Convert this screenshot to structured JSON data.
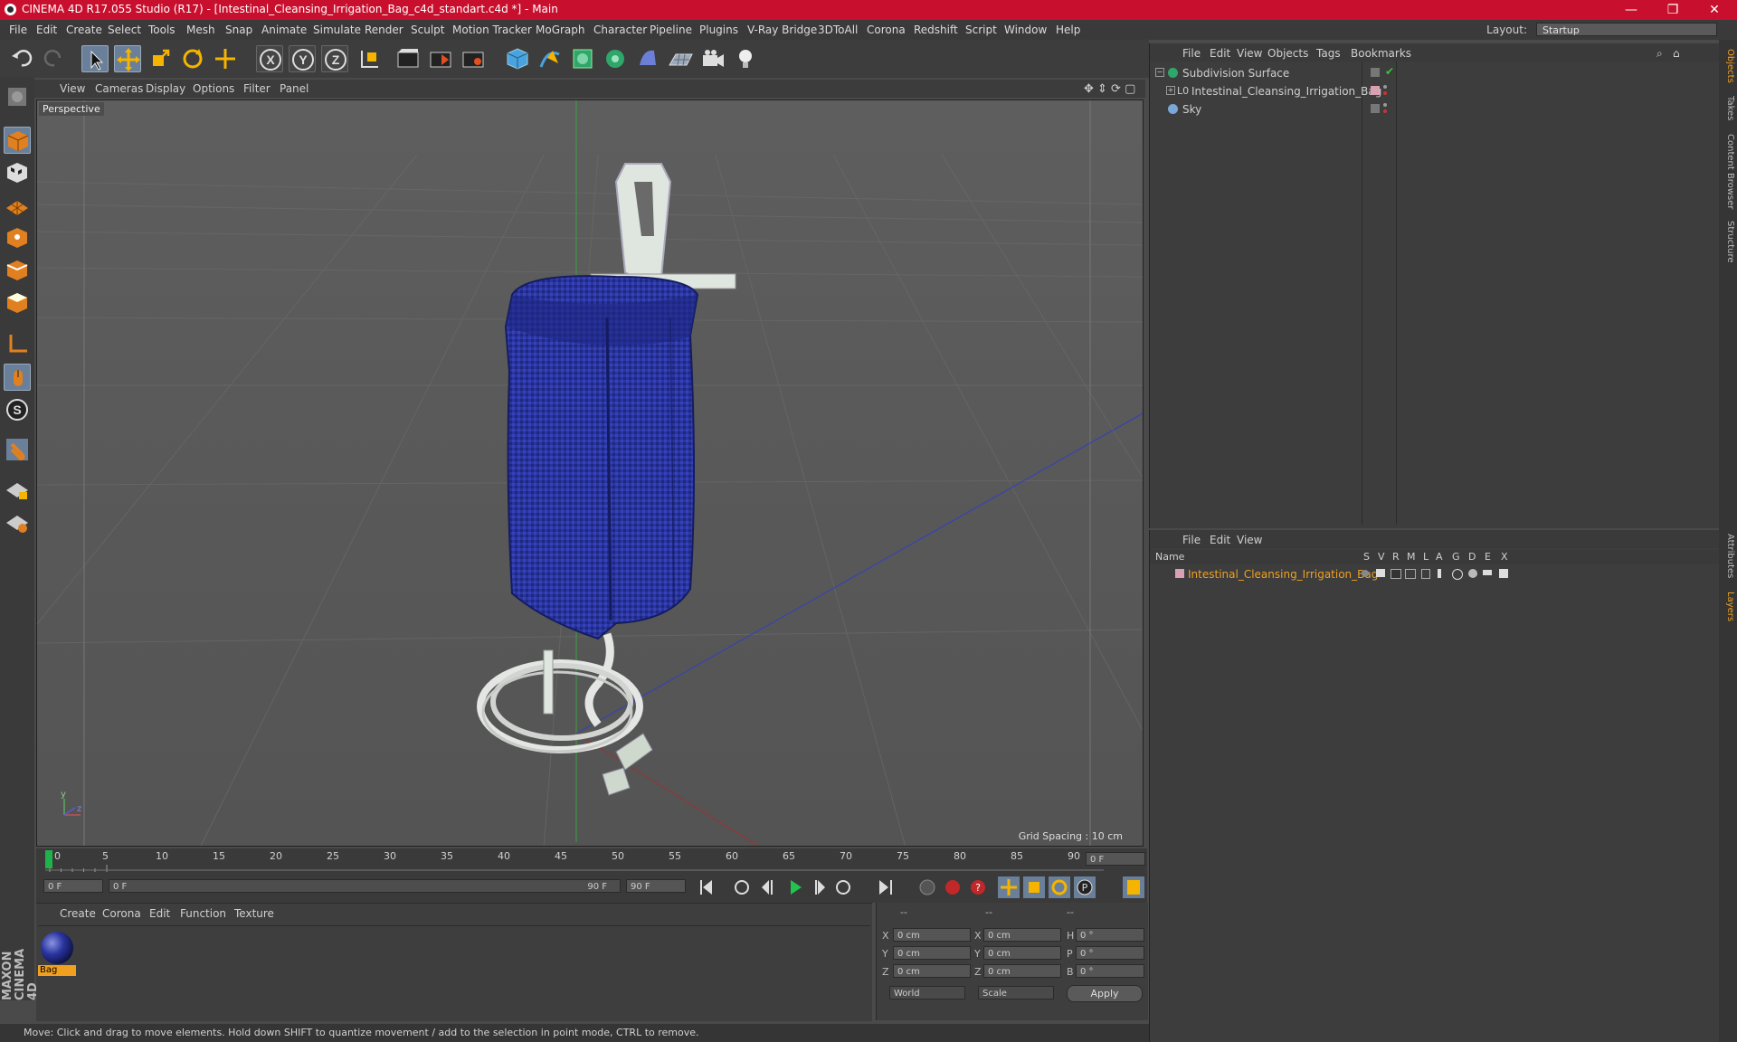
{
  "window": {
    "title": "CINEMA 4D R17.055 Studio (R17) - [Intestinal_Cleansing_Irrigation_Bag_c4d_standart.c4d *] - Main",
    "minimize": "—",
    "maximize": "❐",
    "close": "✕"
  },
  "menubar": {
    "items": [
      "File",
      "Edit",
      "Create",
      "Select",
      "Tools",
      "Mesh",
      "Snap",
      "Animate",
      "Simulate",
      "Render",
      "Sculpt",
      "Motion Tracker",
      "MoGraph",
      "Character",
      "Pipeline",
      "Plugins",
      "V-Ray Bridge",
      "3DToAll",
      "Corona",
      "Redshift",
      "Script",
      "Window",
      "Help"
    ],
    "layout_label": "Layout:",
    "layout_value": "Startup"
  },
  "viewport": {
    "menu": [
      "View",
      "Cameras",
      "Display",
      "Options",
      "Filter",
      "Panel"
    ],
    "camera_label": "Perspective",
    "grid_spacing": "Grid Spacing : 10 cm"
  },
  "timeline": {
    "ticks": [
      "0",
      "5",
      "10",
      "15",
      "20",
      "25",
      "30",
      "35",
      "40",
      "45",
      "50",
      "55",
      "60",
      "65",
      "70",
      "75",
      "80",
      "85",
      "90"
    ],
    "current_frame": "0 F",
    "start_field": "0 F",
    "range_start": "0 F",
    "range_end": "90 F",
    "end_field": "90 F"
  },
  "material_panel": {
    "menu": [
      "Create",
      "Corona",
      "Edit",
      "Function",
      "Texture"
    ],
    "material_name": "Bag"
  },
  "coordinates": {
    "header": [
      "--",
      "--",
      "--"
    ],
    "rows": [
      {
        "a": "X",
        "av": "0 cm",
        "b": "X",
        "bv": "0 cm",
        "c": "H",
        "cv": "0 °"
      },
      {
        "a": "Y",
        "av": "0 cm",
        "b": "Y",
        "bv": "0 cm",
        "c": "P",
        "cv": "0 °"
      },
      {
        "a": "Z",
        "av": "0 cm",
        "b": "Z",
        "bv": "0 cm",
        "c": "B",
        "cv": "0 °"
      }
    ],
    "world": "World",
    "scale": "Scale",
    "apply": "Apply"
  },
  "status": "Move: Click and drag to move elements. Hold down SHIFT to quantize movement / add to the selection in point mode, CTRL to remove.",
  "object_manager": {
    "menu": [
      "File",
      "Edit",
      "View",
      "Objects",
      "Tags",
      "Bookmarks"
    ],
    "objects": [
      "Subdivision Surface",
      "Intestinal_Cleansing_Irrigation_Bag",
      "Sky"
    ]
  },
  "layer_manager": {
    "menu": [
      "File",
      "Edit",
      "View"
    ],
    "columns": [
      "Name",
      "S",
      "V",
      "R",
      "M",
      "L",
      "A",
      "G",
      "D",
      "E",
      "X"
    ],
    "layer": "Intestinal_Cleansing_Irrigation_Bag"
  },
  "side_tabs": [
    "Objects",
    "Takes",
    "Content Browser",
    "Structure",
    "Attributes",
    "Layers"
  ],
  "maxon_logo": "MAXON CINEMA 4D",
  "colors": {
    "title_bar": "#c8102e",
    "accent_layer": "#f0a020",
    "bag": "#2a35a0"
  }
}
